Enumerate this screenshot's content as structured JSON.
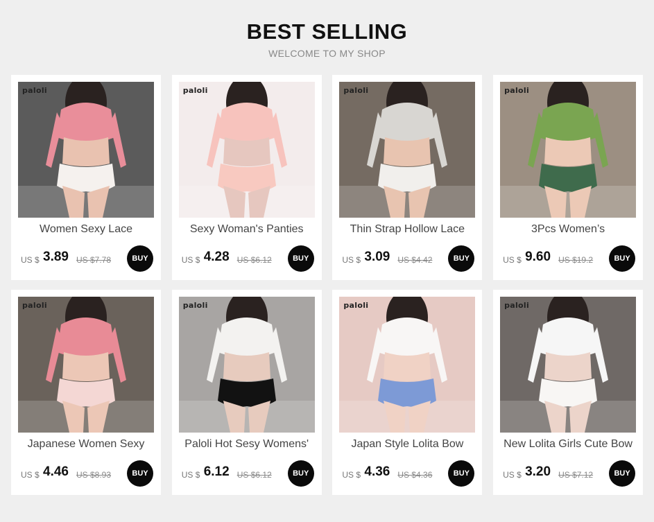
{
  "header": {
    "title": "BEST SELLING",
    "subtitle": "WELCOME TO MY SHOP"
  },
  "products": [
    {
      "name": "Women Sexy Lace",
      "currency": "US $",
      "price": "3.89",
      "old_price": "US $7.78",
      "buy_label": "BUY",
      "brand": "paloli",
      "colors": {
        "bg": "#5b5b5b",
        "skin": "#e9c2b0",
        "top": "#e98e9a",
        "bottom": "#f5f1ee"
      }
    },
    {
      "name": "Sexy Woman's Panties",
      "currency": "US $",
      "price": "4.28",
      "old_price": "US $6.12",
      "buy_label": "BUY",
      "brand": "paloli",
      "colors": {
        "bg": "#f3ecec",
        "skin": "#e6c7bf",
        "top": "#f7c3bd",
        "bottom": "#f8c9c0"
      }
    },
    {
      "name": "Thin Strap Hollow Lace",
      "currency": "US $",
      "price": "3.09",
      "old_price": "US $4.42",
      "buy_label": "BUY",
      "brand": "paloli",
      "colors": {
        "bg": "#756b62",
        "skin": "#e8c4b0",
        "top": "#d8d6d2",
        "bottom": "#f1efec"
      }
    },
    {
      "name": "3Pcs Women’s",
      "currency": "US $",
      "price": "9.60",
      "old_price": "US $19.2",
      "buy_label": "BUY",
      "brand": "paloli",
      "colors": {
        "bg": "#9c8f82",
        "skin": "#ecc9b6",
        "top": "#7aa551",
        "bottom": "#3f6b4c"
      }
    },
    {
      "name": "Japanese Women Sexy",
      "currency": "US $",
      "price": "4.46",
      "old_price": "US $8.93",
      "buy_label": "BUY",
      "brand": "paloli",
      "colors": {
        "bg": "#6a625b",
        "skin": "#ecc7b6",
        "top": "#e88b96",
        "bottom": "#f4d7d4"
      }
    },
    {
      "name": "Paloli Hot Sesy Womens'",
      "currency": "US $",
      "price": "6.12",
      "old_price": "US $6.12",
      "buy_label": "BUY",
      "brand": "paloli",
      "colors": {
        "bg": "#a8a5a3",
        "skin": "#e7cbbe",
        "top": "#f3f2f0",
        "bottom": "#121212"
      }
    },
    {
      "name": "Japan Style Lolita Bow",
      "currency": "US $",
      "price": "4.36",
      "old_price": "US $4.36",
      "buy_label": "BUY",
      "brand": "paloli",
      "colors": {
        "bg": "#e6cac4",
        "skin": "#f0d2c5",
        "top": "#f8f6f5",
        "bottom": "#7d9ad6"
      }
    },
    {
      "name": "New Lolita Girls Cute Bow",
      "currency": "US $",
      "price": "3.20",
      "old_price": "US $7.12",
      "buy_label": "BUY",
      "brand": "paloli",
      "colors": {
        "bg": "#6f6966",
        "skin": "#ecd4ca",
        "top": "#f6f6f6",
        "bottom": "#f8f6f4"
      }
    }
  ]
}
